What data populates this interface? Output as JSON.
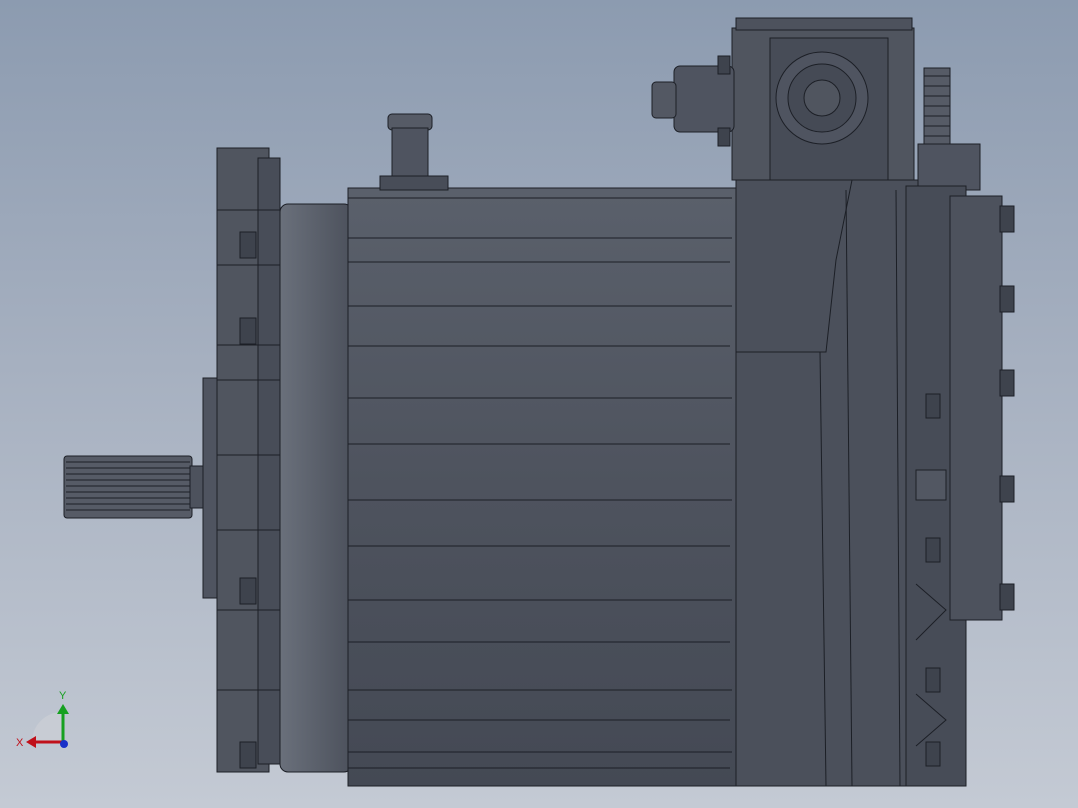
{
  "viewport": {
    "background_top": "#8c9bb0",
    "background_bottom": "#c4cad4",
    "model_color": "#4a4f5a",
    "edge_color": "#1c1f26"
  },
  "triad": {
    "x_label": "X",
    "y_label": "Y",
    "x_color": "#c0101a",
    "y_color": "#16a020",
    "z_color": "#1a30c8"
  }
}
